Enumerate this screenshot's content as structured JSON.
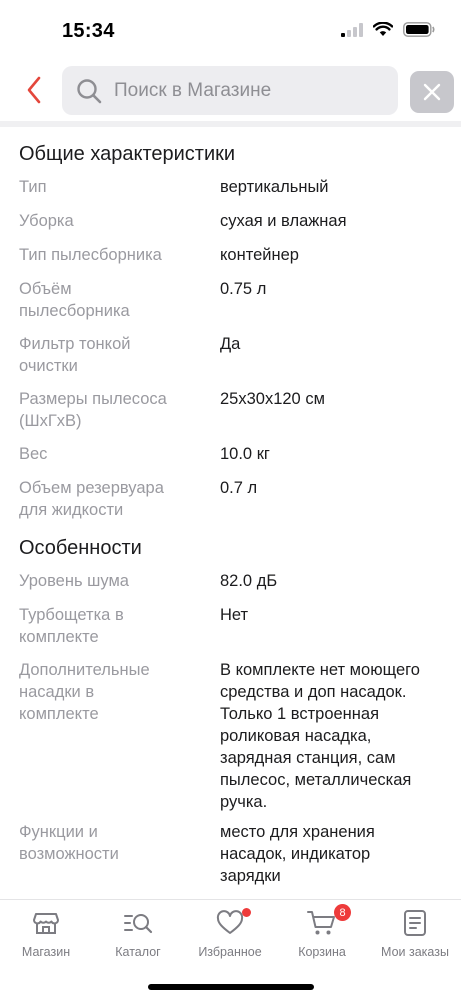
{
  "status_bar": {
    "time": "15:34"
  },
  "search": {
    "placeholder": "Поиск в Магазине"
  },
  "sections": [
    {
      "title": "Общие характеристики",
      "rows": [
        {
          "label": "Тип",
          "value": "вертикальный"
        },
        {
          "label": "Уборка",
          "value": "сухая и влажная"
        },
        {
          "label": "Тип пылесборника",
          "value": "контейнер"
        },
        {
          "label": "Объём\nпылесборника",
          "value": "0.75 л"
        },
        {
          "label": "Фильтр тонкой\nочистки",
          "value": "Да"
        },
        {
          "label": "Размеры пылесоса\n(ШхГхВ)",
          "value": "25х30х120 см"
        },
        {
          "label": "Вес",
          "value": "10.0 кг"
        },
        {
          "label": "Объем резервуара\nдля жидкости",
          "value": "0.7 л"
        }
      ]
    },
    {
      "title": "Особенности",
      "rows": [
        {
          "label": "Уровень шума",
          "value": "82.0 дБ"
        },
        {
          "label": "Турбощетка в\nкомплекте",
          "value": "Нет"
        },
        {
          "label": "Дополнительные\nнасадки в\nкомплекте",
          "value": "В комплекте нет моющего\nсредства и доп насадок.\nТолько 1 встроенная\nроликовая насадка,\nзарядная станция, сам\nпылесос, металлическая\nручка."
        },
        {
          "label": "Функции и\nвозможности",
          "value": "место для хранения\nнасадок, индикатор\nзарядки"
        }
      ]
    }
  ],
  "tab_bar": {
    "items": [
      {
        "label": "Магазин",
        "icon": "store-icon"
      },
      {
        "label": "Каталог",
        "icon": "catalog-search-icon"
      },
      {
        "label": "Избранное",
        "icon": "heart-icon"
      },
      {
        "label": "Корзина",
        "icon": "cart-icon",
        "badge": "8"
      },
      {
        "label": "Мои заказы",
        "icon": "orders-icon"
      }
    ]
  },
  "colors": {
    "accent": "#e4473c",
    "badge": "#ee3b3b",
    "label_gray": "#9a9aa0"
  }
}
